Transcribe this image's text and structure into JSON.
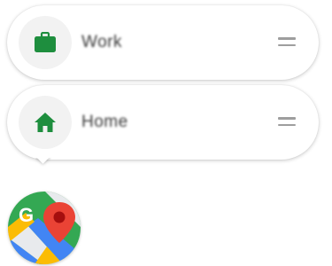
{
  "shortcuts": [
    {
      "label": "Work",
      "icon": "briefcase-icon",
      "accent": "#1e8e3e"
    },
    {
      "label": "Home",
      "icon": "home-icon",
      "accent": "#1e8e3e"
    }
  ],
  "app_icon": {
    "name": "google-maps-app-icon",
    "letter": "G"
  },
  "colors": {
    "accent_green": "#1e8e3e",
    "maps_green": "#34a853",
    "maps_blue": "#4285f4",
    "maps_yellow": "#fbbc04",
    "maps_red": "#ea4335",
    "maps_grey": "#e8eaed"
  }
}
